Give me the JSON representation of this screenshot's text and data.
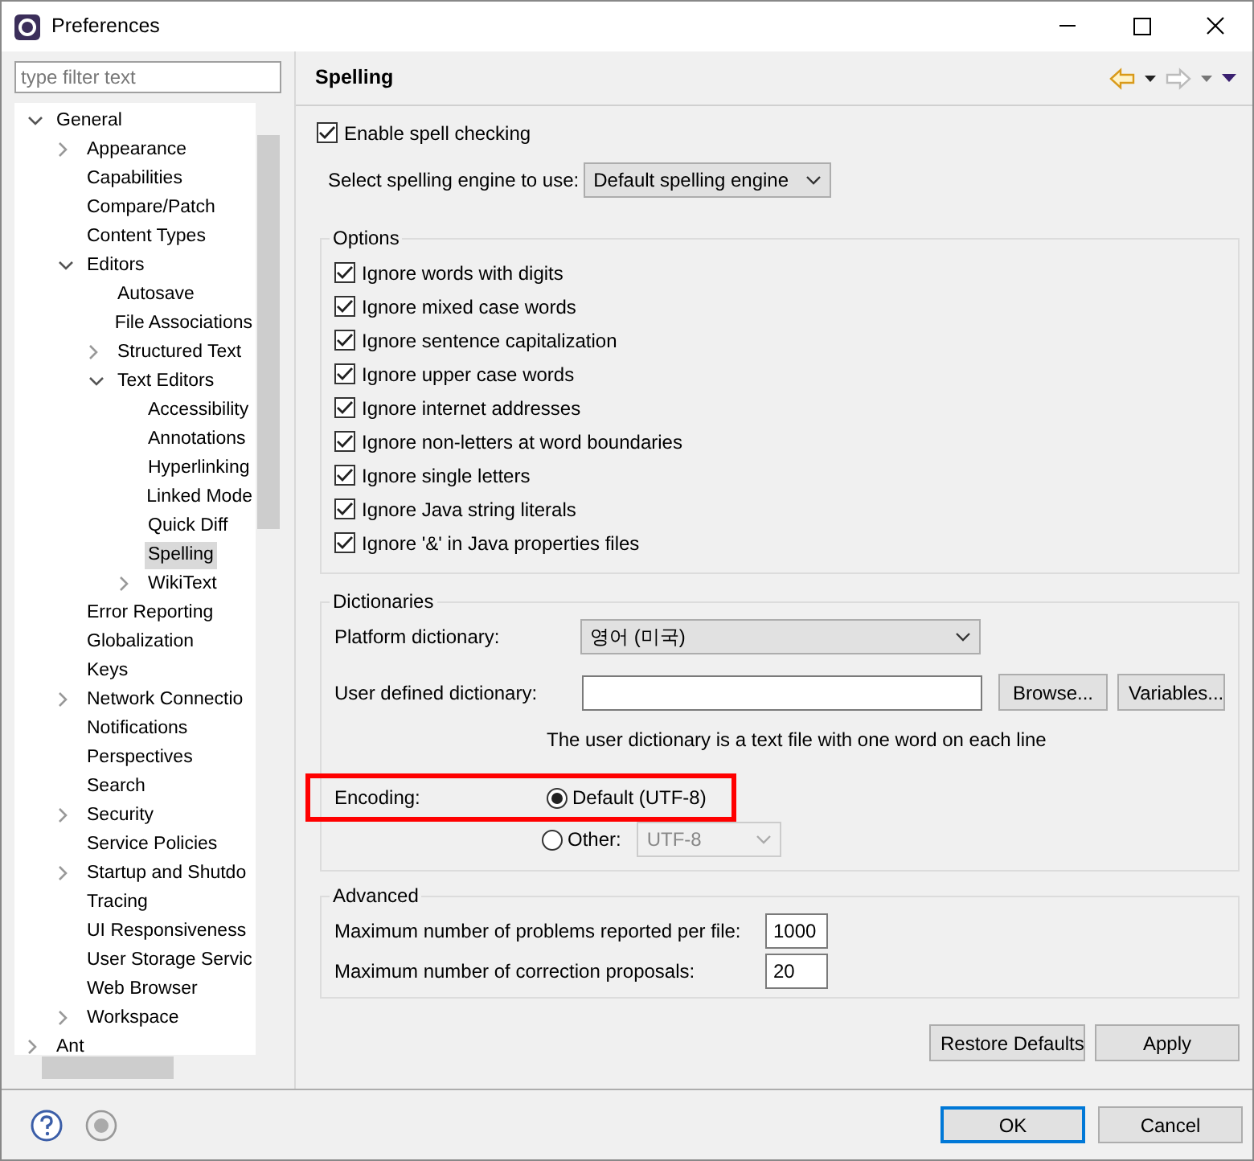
{
  "window": {
    "title": "Preferences"
  },
  "filter": {
    "placeholder": "type filter text"
  },
  "tree": [
    {
      "label": "General",
      "expanded": true,
      "selected": false,
      "children": [
        {
          "label": "Appearance",
          "expanded": false,
          "selected": false
        },
        {
          "label": "Capabilities",
          "selected": false
        },
        {
          "label": "Compare/Patch",
          "selected": false
        },
        {
          "label": "Content Types",
          "selected": false
        },
        {
          "label": "Editors",
          "expanded": true,
          "selected": false,
          "children": [
            {
              "label": "Autosave",
              "selected": false
            },
            {
              "label": "File Associations",
              "selected": false
            },
            {
              "label": "Structured Text",
              "expanded": false,
              "selected": false
            },
            {
              "label": "Text Editors",
              "expanded": true,
              "selected": false,
              "children": [
                {
                  "label": "Accessibility",
                  "selected": false
                },
                {
                  "label": "Annotations",
                  "selected": false
                },
                {
                  "label": "Hyperlinking",
                  "selected": false
                },
                {
                  "label": "Linked Mode",
                  "selected": false
                },
                {
                  "label": "Quick Diff",
                  "selected": false
                },
                {
                  "label": "Spelling",
                  "selected": true
                },
                {
                  "label": "WikiText",
                  "expanded": false,
                  "selected": false
                }
              ]
            }
          ]
        },
        {
          "label": "Error Reporting",
          "selected": false
        },
        {
          "label": "Globalization",
          "selected": false
        },
        {
          "label": "Keys",
          "selected": false
        },
        {
          "label": "Network Connectio",
          "expanded": false,
          "selected": false
        },
        {
          "label": "Notifications",
          "selected": false
        },
        {
          "label": "Perspectives",
          "selected": false
        },
        {
          "label": "Search",
          "selected": false
        },
        {
          "label": "Security",
          "expanded": false,
          "selected": false
        },
        {
          "label": "Service Policies",
          "selected": false
        },
        {
          "label": "Startup and Shutdo",
          "expanded": false,
          "selected": false
        },
        {
          "label": "Tracing",
          "selected": false
        },
        {
          "label": "UI Responsiveness",
          "selected": false
        },
        {
          "label": "User Storage Servic",
          "selected": false
        },
        {
          "label": "Web Browser",
          "selected": false
        },
        {
          "label": "Workspace",
          "expanded": false,
          "selected": false
        }
      ]
    },
    {
      "label": "Ant",
      "expanded": false,
      "selected": false
    }
  ],
  "page": {
    "title": "Spelling"
  },
  "enable": {
    "label": "Enable spell checking",
    "checked": true
  },
  "engine": {
    "label": "Select spelling engine to use:",
    "value": "Default spelling engine"
  },
  "options": {
    "title": "Options",
    "items": [
      {
        "label": "Ignore words with digits",
        "checked": true
      },
      {
        "label": "Ignore mixed case words",
        "checked": true
      },
      {
        "label": "Ignore sentence capitalization",
        "checked": true
      },
      {
        "label": "Ignore upper case words",
        "checked": true
      },
      {
        "label": "Ignore internet addresses",
        "checked": true
      },
      {
        "label": "Ignore non-letters at word boundaries",
        "checked": true
      },
      {
        "label": "Ignore single letters",
        "checked": true
      },
      {
        "label": "Ignore Java string literals",
        "checked": true
      },
      {
        "label": "Ignore '&' in Java properties files",
        "checked": true
      }
    ]
  },
  "dictionaries": {
    "title": "Dictionaries",
    "platform_label": "Platform dictionary:",
    "platform_value": "영어 (미국)",
    "user_label": "User defined dictionary:",
    "browse": "Browse...",
    "variables": "Variables...",
    "hint": "The user dictionary is a text file with one word on each line",
    "encoding": {
      "label": "Encoding:",
      "highlighted": true,
      "choices": [
        {
          "label": "Default (UTF-8)",
          "selected": true
        },
        {
          "label": "Other:",
          "selected": false,
          "value": "UTF-8"
        }
      ]
    }
  },
  "advanced": {
    "title": "Advanced",
    "fields": [
      {
        "label": "Maximum number of problems reported per file:",
        "value": "1000"
      },
      {
        "label": "Maximum number of correction proposals:",
        "value": "20"
      }
    ]
  },
  "buttons": {
    "restore": "Restore Defaults",
    "apply": "Apply",
    "ok": "OK",
    "cancel": "Cancel"
  }
}
